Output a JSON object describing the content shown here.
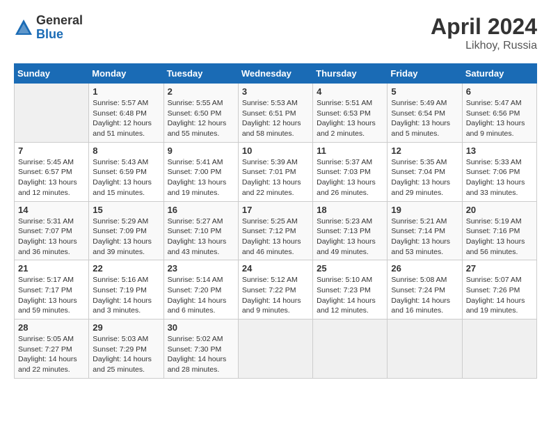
{
  "header": {
    "logo_general": "General",
    "logo_blue": "Blue",
    "month_year": "April 2024",
    "location": "Likhoy, Russia"
  },
  "days_of_week": [
    "Sunday",
    "Monday",
    "Tuesday",
    "Wednesday",
    "Thursday",
    "Friday",
    "Saturday"
  ],
  "weeks": [
    [
      {
        "day": "",
        "info": ""
      },
      {
        "day": "1",
        "info": "Sunrise: 5:57 AM\nSunset: 6:48 PM\nDaylight: 12 hours\nand 51 minutes."
      },
      {
        "day": "2",
        "info": "Sunrise: 5:55 AM\nSunset: 6:50 PM\nDaylight: 12 hours\nand 55 minutes."
      },
      {
        "day": "3",
        "info": "Sunrise: 5:53 AM\nSunset: 6:51 PM\nDaylight: 12 hours\nand 58 minutes."
      },
      {
        "day": "4",
        "info": "Sunrise: 5:51 AM\nSunset: 6:53 PM\nDaylight: 13 hours\nand 2 minutes."
      },
      {
        "day": "5",
        "info": "Sunrise: 5:49 AM\nSunset: 6:54 PM\nDaylight: 13 hours\nand 5 minutes."
      },
      {
        "day": "6",
        "info": "Sunrise: 5:47 AM\nSunset: 6:56 PM\nDaylight: 13 hours\nand 9 minutes."
      }
    ],
    [
      {
        "day": "7",
        "info": "Sunrise: 5:45 AM\nSunset: 6:57 PM\nDaylight: 13 hours\nand 12 minutes."
      },
      {
        "day": "8",
        "info": "Sunrise: 5:43 AM\nSunset: 6:59 PM\nDaylight: 13 hours\nand 15 minutes."
      },
      {
        "day": "9",
        "info": "Sunrise: 5:41 AM\nSunset: 7:00 PM\nDaylight: 13 hours\nand 19 minutes."
      },
      {
        "day": "10",
        "info": "Sunrise: 5:39 AM\nSunset: 7:01 PM\nDaylight: 13 hours\nand 22 minutes."
      },
      {
        "day": "11",
        "info": "Sunrise: 5:37 AM\nSunset: 7:03 PM\nDaylight: 13 hours\nand 26 minutes."
      },
      {
        "day": "12",
        "info": "Sunrise: 5:35 AM\nSunset: 7:04 PM\nDaylight: 13 hours\nand 29 minutes."
      },
      {
        "day": "13",
        "info": "Sunrise: 5:33 AM\nSunset: 7:06 PM\nDaylight: 13 hours\nand 33 minutes."
      }
    ],
    [
      {
        "day": "14",
        "info": "Sunrise: 5:31 AM\nSunset: 7:07 PM\nDaylight: 13 hours\nand 36 minutes."
      },
      {
        "day": "15",
        "info": "Sunrise: 5:29 AM\nSunset: 7:09 PM\nDaylight: 13 hours\nand 39 minutes."
      },
      {
        "day": "16",
        "info": "Sunrise: 5:27 AM\nSunset: 7:10 PM\nDaylight: 13 hours\nand 43 minutes."
      },
      {
        "day": "17",
        "info": "Sunrise: 5:25 AM\nSunset: 7:12 PM\nDaylight: 13 hours\nand 46 minutes."
      },
      {
        "day": "18",
        "info": "Sunrise: 5:23 AM\nSunset: 7:13 PM\nDaylight: 13 hours\nand 49 minutes."
      },
      {
        "day": "19",
        "info": "Sunrise: 5:21 AM\nSunset: 7:14 PM\nDaylight: 13 hours\nand 53 minutes."
      },
      {
        "day": "20",
        "info": "Sunrise: 5:19 AM\nSunset: 7:16 PM\nDaylight: 13 hours\nand 56 minutes."
      }
    ],
    [
      {
        "day": "21",
        "info": "Sunrise: 5:17 AM\nSunset: 7:17 PM\nDaylight: 13 hours\nand 59 minutes."
      },
      {
        "day": "22",
        "info": "Sunrise: 5:16 AM\nSunset: 7:19 PM\nDaylight: 14 hours\nand 3 minutes."
      },
      {
        "day": "23",
        "info": "Sunrise: 5:14 AM\nSunset: 7:20 PM\nDaylight: 14 hours\nand 6 minutes."
      },
      {
        "day": "24",
        "info": "Sunrise: 5:12 AM\nSunset: 7:22 PM\nDaylight: 14 hours\nand 9 minutes."
      },
      {
        "day": "25",
        "info": "Sunrise: 5:10 AM\nSunset: 7:23 PM\nDaylight: 14 hours\nand 12 minutes."
      },
      {
        "day": "26",
        "info": "Sunrise: 5:08 AM\nSunset: 7:24 PM\nDaylight: 14 hours\nand 16 minutes."
      },
      {
        "day": "27",
        "info": "Sunrise: 5:07 AM\nSunset: 7:26 PM\nDaylight: 14 hours\nand 19 minutes."
      }
    ],
    [
      {
        "day": "28",
        "info": "Sunrise: 5:05 AM\nSunset: 7:27 PM\nDaylight: 14 hours\nand 22 minutes."
      },
      {
        "day": "29",
        "info": "Sunrise: 5:03 AM\nSunset: 7:29 PM\nDaylight: 14 hours\nand 25 minutes."
      },
      {
        "day": "30",
        "info": "Sunrise: 5:02 AM\nSunset: 7:30 PM\nDaylight: 14 hours\nand 28 minutes."
      },
      {
        "day": "",
        "info": ""
      },
      {
        "day": "",
        "info": ""
      },
      {
        "day": "",
        "info": ""
      },
      {
        "day": "",
        "info": ""
      }
    ]
  ]
}
